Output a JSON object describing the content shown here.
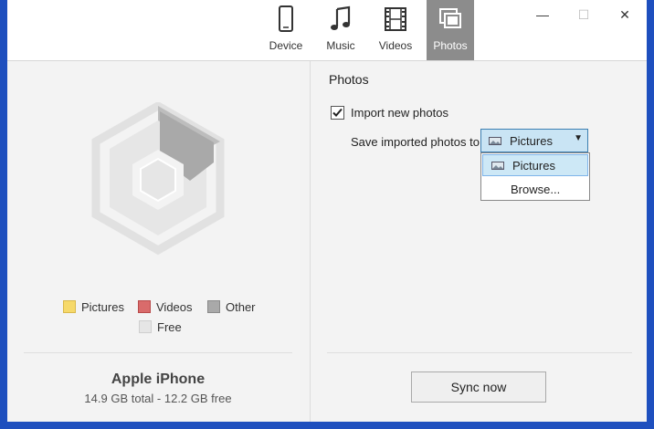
{
  "nav": {
    "tabs": [
      {
        "label": "Device",
        "icon": "phone-icon"
      },
      {
        "label": "Music",
        "icon": "music-note-icon"
      },
      {
        "label": "Videos",
        "icon": "film-icon"
      },
      {
        "label": "Photos",
        "icon": "photos-icon"
      }
    ],
    "active_tab": "Photos"
  },
  "window_controls": {
    "minimize": "—",
    "maximize": "☐",
    "close": "✕"
  },
  "storage": {
    "legend": [
      {
        "label": "Pictures",
        "color": "#f6d96a"
      },
      {
        "label": "Videos",
        "color": "#d96b6b"
      },
      {
        "label": "Other",
        "color": "#a9a9a9"
      },
      {
        "label": "Free",
        "color": "#e6e6e6"
      }
    ],
    "device_name": "Apple iPhone",
    "capacity": "14.9 GB total - 12.2 GB free"
  },
  "photos": {
    "section_title": "Photos",
    "import_label": "Import new photos",
    "import_checked": true,
    "save_label": "Save imported photos to",
    "destination": "Pictures",
    "options": [
      "Pictures",
      "Browse..."
    ]
  },
  "sync_button": "Sync now"
}
